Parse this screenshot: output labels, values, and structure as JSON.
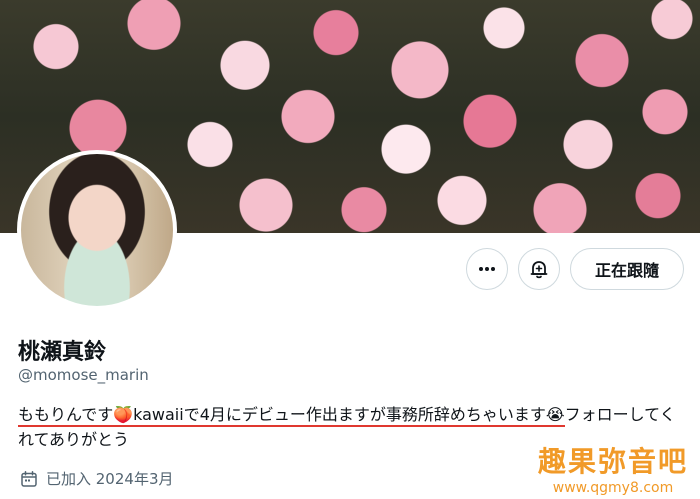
{
  "profile": {
    "display_name": "桃瀬真鈴",
    "handle": "@momose_marin",
    "bio_part1": "ももりんです🍑kawaiiで4月にデビュー作出ますが事務所辞めちゃいます😭",
    "bio_part2": "フォローしてくれてありがとう",
    "joined": "已加入 2024年3月"
  },
  "actions": {
    "more_icon": "more-horizontal-icon",
    "notify_icon": "bell-plus-icon",
    "follow_label": "正在跟隨"
  },
  "watermark": {
    "title": "趣果弥音吧",
    "url": "www.qgmy8.com"
  },
  "colors": {
    "text": "#0f1419",
    "secondary": "#536471",
    "border": "#cfd9de",
    "underline": "#e0382f",
    "watermark": "#f19a28"
  }
}
